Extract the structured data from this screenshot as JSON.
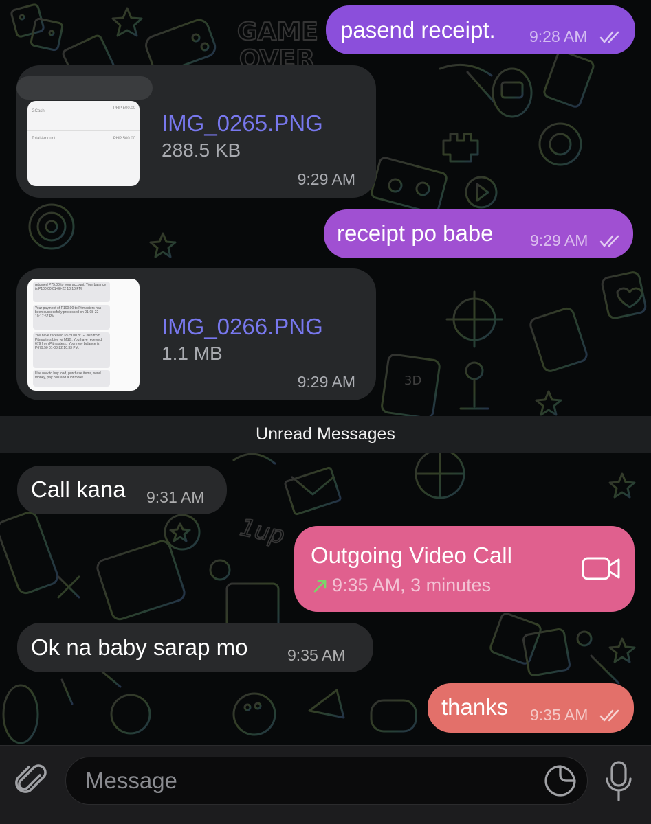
{
  "wallpaper": {
    "doodle_text_1": "GAME",
    "doodle_text_2": "OVER",
    "doodle_text_3": "3D",
    "doodle_text_4": "1up"
  },
  "messages": [
    {
      "type": "outgoing_text",
      "text": "pasend receipt.",
      "time": "9:28 AM",
      "status": "read",
      "color": "#8b4fdb"
    },
    {
      "type": "incoming_file",
      "file_name": "IMG_0265.PNG",
      "file_size": "288.5 KB",
      "time": "9:29 AM",
      "thumb_lines": [
        "GCash",
        "PHP 500.00",
        "Total Amount",
        "PHP 500.00"
      ]
    },
    {
      "type": "outgoing_text",
      "text": "receipt po babe",
      "time": "9:29 AM",
      "status": "read",
      "color": "#a050d2"
    },
    {
      "type": "incoming_file",
      "file_name": "IMG_0266.PNG",
      "file_size": "1.1 MB",
      "time": "9:29 AM",
      "thumb_lines": [
        "returned P75.00 to your account. Your balance is P100.00 01-08-22 10:10 PM.",
        "Your payment of P100.00 to Pitmasters has been successfully processed on 01-08-22 10:17:57 PM.",
        "You have received P679.00 of GCash from Pitmasters Live w/ MSG. You have received 679 from Pitmasters.. Your new balance is P679.50 01-08-22 10:33 PM.",
        "Use now to buy load, purchase items, send money, pay bills and a lot more!"
      ]
    },
    {
      "type": "divider",
      "text": "Unread Messages"
    },
    {
      "type": "incoming_text",
      "text": "Call kana",
      "time": "9:31 AM"
    },
    {
      "type": "outgoing_call",
      "title": "Outgoing Video Call",
      "detail": "9:35 AM, 3 minutes",
      "color": "#e0608e"
    },
    {
      "type": "incoming_text",
      "text": "Ok na baby sarap mo",
      "time": "9:35 AM"
    },
    {
      "type": "outgoing_text",
      "text": "thanks",
      "time": "9:35 AM",
      "status": "read",
      "color": "#e3706a"
    }
  ],
  "input": {
    "placeholder": "Message"
  },
  "icons": {
    "attach": "paperclip-icon",
    "sticker": "sticker-icon",
    "mic": "microphone-icon",
    "video": "video-camera-icon",
    "call_arrow": "outgoing-arrow-icon",
    "ticks": "double-check-icon"
  }
}
